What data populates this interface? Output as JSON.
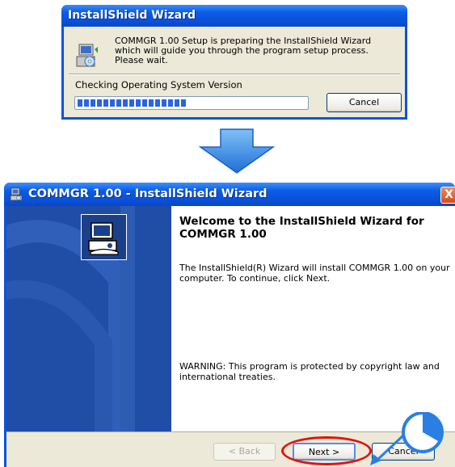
{
  "small_dialog": {
    "title": "InstallShield Wizard",
    "message": "COMMGR 1.00 Setup is preparing the InstallShield Wizard which will guide you through the program setup process.  Please wait.",
    "status": "Checking Operating System Version",
    "progress_percent": 47,
    "cancel_label": "Cancel"
  },
  "wizard": {
    "title": "COMMGR 1.00 - InstallShield Wizard",
    "close_label": "X",
    "welcome_heading": "Welcome to the InstallShield Wizard for COMMGR 1.00",
    "intro_text": "The InstallShield(R) Wizard will install COMMGR 1.00 on your computer. To continue, click Next.",
    "warning_text": "WARNING: This program is protected by copyright law and international treaties.",
    "back_label": "< Back",
    "next_label": "Next >",
    "cancel_label": "Cancel"
  },
  "colors": {
    "title_blue": "#0a50d8",
    "side_panel_blue": "#204da6",
    "highlight_red": "#e0140f",
    "arrow_blue": "#2a7fe3"
  }
}
